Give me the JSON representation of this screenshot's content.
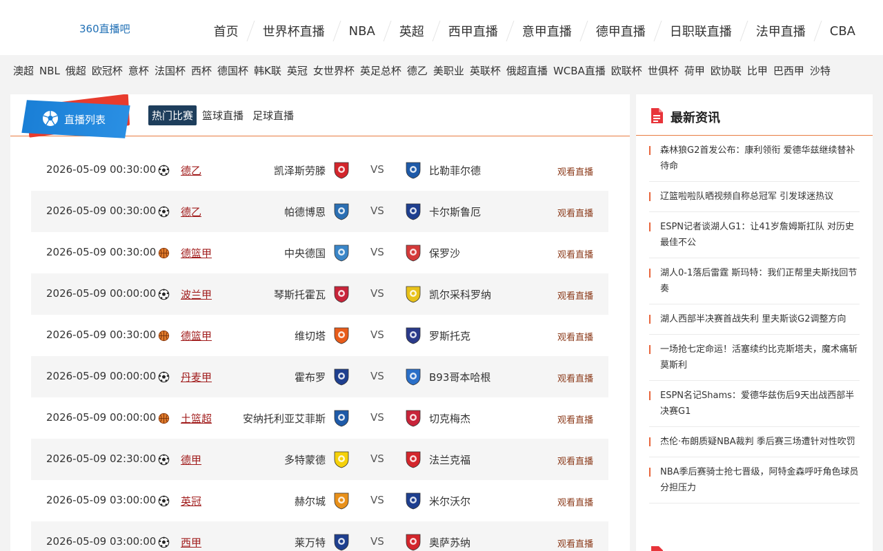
{
  "header": {
    "logo": "360直播吧",
    "nav": [
      "首页",
      "世界杯直播",
      "NBA",
      "英超",
      "西甲直播",
      "意甲直播",
      "德甲直播",
      "日职联直播",
      "法甲直播",
      "CBA"
    ]
  },
  "leagues": [
    "澳超",
    "NBL",
    "俄超",
    "欧冠杯",
    "意杯",
    "法国杯",
    "西杯",
    "德国杯",
    "韩K联",
    "英冠",
    "女世界杯",
    "英足总杯",
    "德乙",
    "美职业",
    "英联杯",
    "俄超直播",
    "WCBA直播",
    "欧联杯",
    "世俱杯",
    "荷甲",
    "欧协联",
    "比甲",
    "巴西甲",
    "沙特"
  ],
  "main": {
    "section_title": "直播列表",
    "tabs": [
      "热门比赛",
      "篮球直播",
      "足球直播"
    ],
    "active_tab": 0,
    "vs_label": "VS",
    "watch_label": "观看直播",
    "matches": [
      {
        "time": "2026-05-09 00:30:00",
        "sport": "football",
        "league": "德乙",
        "home": "凯泽斯劳滕",
        "away": "比勒菲尔德",
        "home_color": "#d3262c",
        "away_color": "#1e5aa8"
      },
      {
        "time": "2026-05-09 00:30:00",
        "sport": "football",
        "league": "德乙",
        "home": "帕德博恩",
        "away": "卡尔斯鲁厄",
        "home_color": "#2b6fb3",
        "away_color": "#1e3f8f"
      },
      {
        "time": "2026-05-09 00:30:00",
        "sport": "basketball",
        "league": "德篮甲",
        "home": "中央德国",
        "away": "保罗沙",
        "home_color": "#3a86c8",
        "away_color": "#d43a3a"
      },
      {
        "time": "2026-05-09 00:00:00",
        "sport": "football",
        "league": "波兰甲",
        "home": "琴斯托霍瓦",
        "away": "凯尔采科罗纳",
        "home_color": "#c8243a",
        "away_color": "#e8c21a"
      },
      {
        "time": "2026-05-09 00:30:00",
        "sport": "basketball",
        "league": "德篮甲",
        "home": "维切塔",
        "away": "罗斯托克",
        "home_color": "#e85c1a",
        "away_color": "#2a3a8a"
      },
      {
        "time": "2026-05-09 00:00:00",
        "sport": "football",
        "league": "丹麦甲",
        "home": "霍布罗",
        "away": "B93哥本哈根",
        "home_color": "#1e3f8f",
        "away_color": "#2a6fc8"
      },
      {
        "time": "2026-05-09 00:00:00",
        "sport": "basketball",
        "league": "土篮超",
        "home": "安纳托利亚艾菲斯",
        "away": "切克梅杰",
        "home_color": "#1e5aa8",
        "away_color": "#c8243a"
      },
      {
        "time": "2026-05-09 02:30:00",
        "sport": "football",
        "league": "德甲",
        "home": "多特蒙德",
        "away": "法兰克福",
        "home_color": "#f5d10a",
        "away_color": "#d3262c"
      },
      {
        "time": "2026-05-09 03:00:00",
        "sport": "football",
        "league": "英冠",
        "home": "赫尔城",
        "away": "米尔沃尔",
        "home_color": "#e8901a",
        "away_color": "#1e3f8f"
      },
      {
        "time": "2026-05-09 03:00:00",
        "sport": "football",
        "league": "西甲",
        "home": "莱万特",
        "away": "奥萨苏纳",
        "home_color": "#1e3f8f",
        "away_color": "#d3262c"
      }
    ]
  },
  "side": {
    "title": "最新资讯",
    "news": [
      "森林狼G2首发公布：康利领衔 爱德华兹继续替补待命",
      "辽篮啦啦队晒视频自称总冠军 引发球迷热议",
      "ESPN记者谈湖人G1：让41岁詹姆斯扛队 对历史最佳不公",
      "湖人0-1落后雷霆 斯玛特：我们正帮里夫斯找回节奏",
      "湖人西部半决赛首战失利 里夫斯谈G2调整方向",
      "一场抢七定命运！活塞续约比克斯塔夫，魔术痛斩莫斯利",
      "ESPN名记Shams：爱德华兹伤后9天出战西部半决赛G1",
      "杰伦·布朗质疑NBA裁判 季后赛三场遭针对性吹罚",
      "NBA季后赛骑士抢七晋级，阿特金森呼吁角色球员分担压力"
    ]
  },
  "colors": {
    "accent": "#e87a3f",
    "league_link": "#a11d1d",
    "watch": "#8b3a1a",
    "tab_active_bg": "#1e3e5c",
    "badge_blue": "#1a7fd6",
    "badge_red": "#e83b2d"
  }
}
